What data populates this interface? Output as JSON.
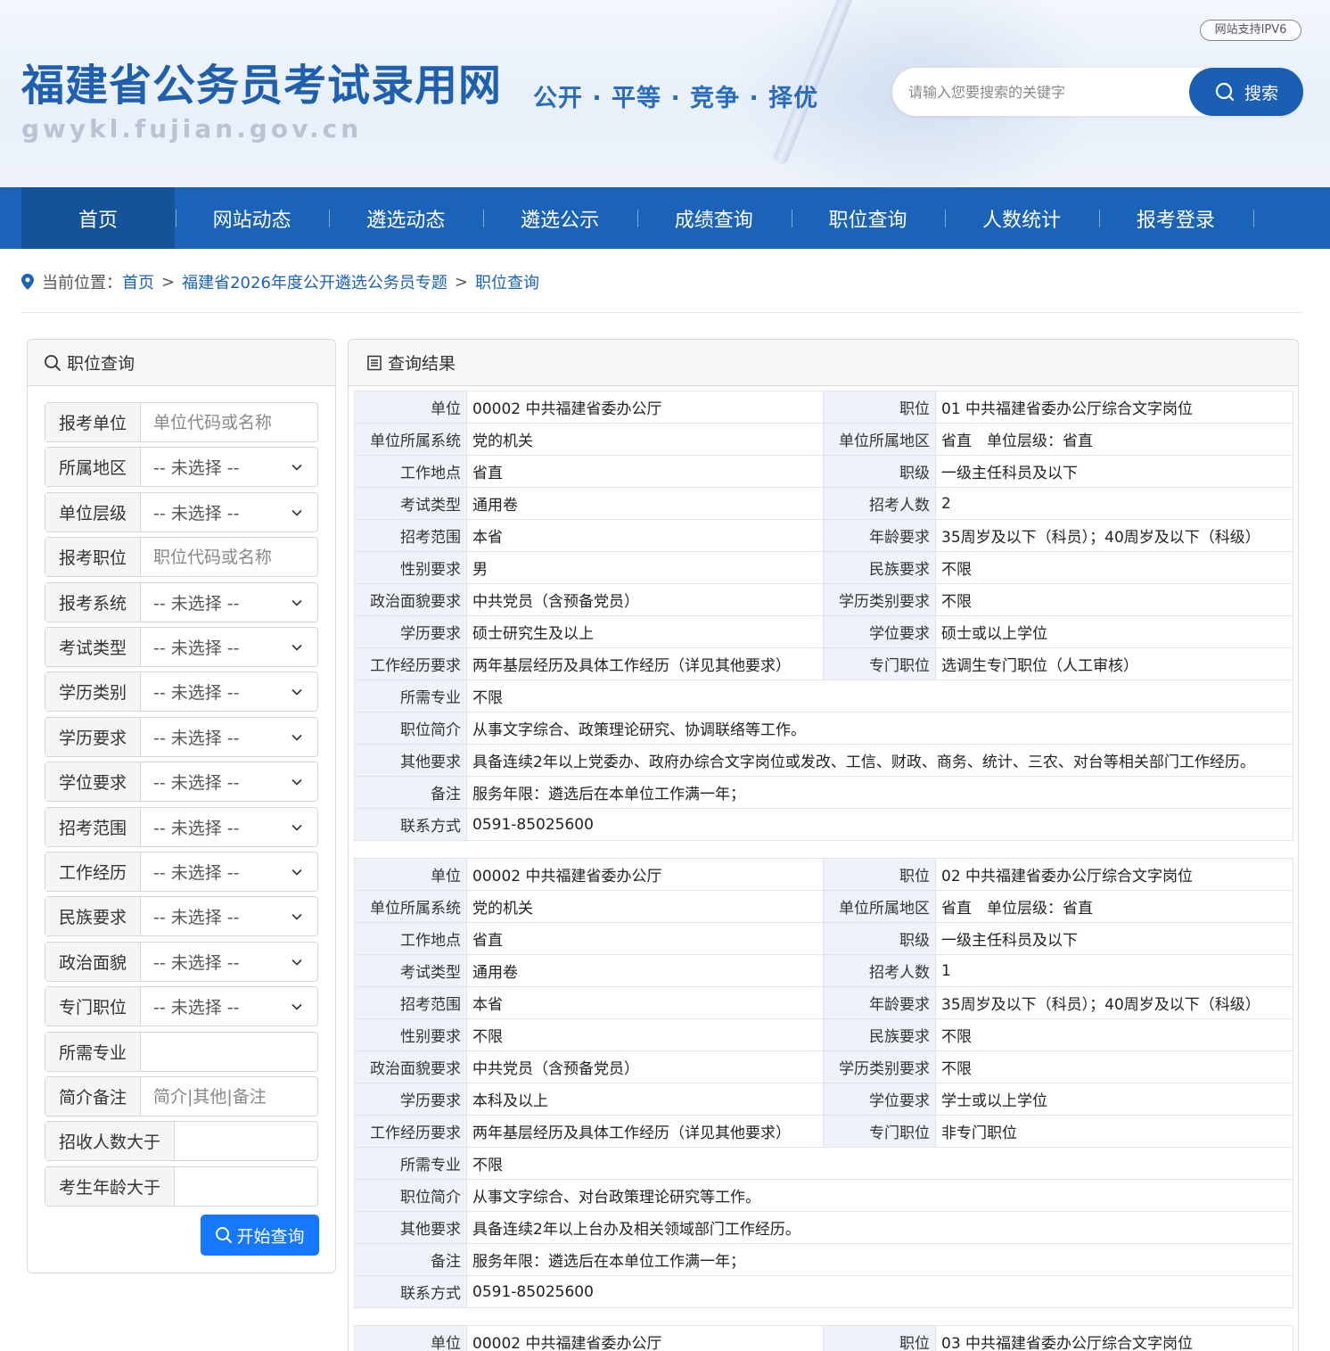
{
  "header": {
    "site_title": "福建省公务员考试录用网",
    "site_domain": "gwykl.fujian.gov.cn",
    "slogan": "公开 · 平等 · 竞争 · 择优",
    "ipv6_badge": "网站支持IPV6",
    "search_placeholder": "请输入您要搜索的关键字",
    "search_button": "搜索"
  },
  "nav": [
    "首页",
    "网站动态",
    "遴选动态",
    "遴选公示",
    "成绩查询",
    "职位查询",
    "人数统计",
    "报考登录"
  ],
  "breadcrumb": {
    "prefix": "当前位置：",
    "items": [
      "首页",
      "福建省2026年度公开遴选公务员专题",
      "职位查询"
    ],
    "sep": ">"
  },
  "left_panel": {
    "title": "职位查询",
    "fields": [
      {
        "label": "报考单位",
        "type": "input",
        "placeholder": "单位代码或名称",
        "value": ""
      },
      {
        "label": "所属地区",
        "type": "select",
        "value": "-- 未选择 --"
      },
      {
        "label": "单位层级",
        "type": "select",
        "value": "-- 未选择 --"
      },
      {
        "label": "报考职位",
        "type": "input",
        "placeholder": "职位代码或名称",
        "value": ""
      },
      {
        "label": "报考系统",
        "type": "select",
        "value": "-- 未选择 --"
      },
      {
        "label": "考试类型",
        "type": "select",
        "value": "-- 未选择 --"
      },
      {
        "label": "学历类别",
        "type": "select",
        "value": "-- 未选择 --"
      },
      {
        "label": "学历要求",
        "type": "select",
        "value": "-- 未选择 --"
      },
      {
        "label": "学位要求",
        "type": "select",
        "value": "-- 未选择 --"
      },
      {
        "label": "招考范围",
        "type": "select",
        "value": "-- 未选择 --"
      },
      {
        "label": "工作经历",
        "type": "select",
        "value": "-- 未选择 --"
      },
      {
        "label": "民族要求",
        "type": "select",
        "value": "-- 未选择 --"
      },
      {
        "label": "政治面貌",
        "type": "select",
        "value": "-- 未选择 --"
      },
      {
        "label": "专门职位",
        "type": "select",
        "value": "-- 未选择 --"
      },
      {
        "label": "所需专业",
        "type": "input",
        "placeholder": "",
        "value": ""
      },
      {
        "label": "简介备注",
        "type": "input",
        "placeholder": "简介|其他|备注",
        "value": ""
      },
      {
        "label": "招收人数大于",
        "type": "input",
        "placeholder": "",
        "value": ""
      },
      {
        "label": "考生年龄大于",
        "type": "input",
        "placeholder": "",
        "value": ""
      }
    ],
    "submit": "开始查询"
  },
  "right_panel": {
    "title": "查询结果",
    "results": [
      {
        "pairs": [
          [
            "单位",
            "00002 中共福建省委办公厅",
            "职位",
            "01 中共福建省委办公厅综合文字岗位"
          ],
          [
            "单位所属系统",
            "党的机关",
            "单位所属地区",
            "省直　单位层级：省直"
          ],
          [
            "工作地点",
            "省直",
            "职级",
            "一级主任科员及以下"
          ],
          [
            "考试类型",
            "通用卷",
            "招考人数",
            "2"
          ],
          [
            "招考范围",
            "本省",
            "年龄要求",
            "35周岁及以下（科员）；40周岁及以下（科级）"
          ],
          [
            "性别要求",
            "男",
            "民族要求",
            "不限"
          ],
          [
            "政治面貌要求",
            "中共党员（含预备党员）",
            "学历类别要求",
            "不限"
          ],
          [
            "学历要求",
            "硕士研究生及以上",
            "学位要求",
            "硕士或以上学位"
          ],
          [
            "工作经历要求",
            "两年基层经历及具体工作经历（详见其他要求）",
            "专门职位",
            "选调生专门职位（人工审核）"
          ]
        ],
        "full": [
          [
            "所需专业",
            "不限"
          ],
          [
            "职位简介",
            "从事文字综合、政策理论研究、协调联络等工作。"
          ],
          [
            "其他要求",
            "具备连续2年以上党委办、政府办综合文字岗位或发改、工信、财政、商务、统计、三农、对台等相关部门工作经历。"
          ],
          [
            "备注",
            "服务年限：遴选后在本单位工作满一年；"
          ],
          [
            "联系方式",
            "0591-85025600"
          ]
        ]
      },
      {
        "pairs": [
          [
            "单位",
            "00002 中共福建省委办公厅",
            "职位",
            "02 中共福建省委办公厅综合文字岗位"
          ],
          [
            "单位所属系统",
            "党的机关",
            "单位所属地区",
            "省直　单位层级：省直"
          ],
          [
            "工作地点",
            "省直",
            "职级",
            "一级主任科员及以下"
          ],
          [
            "考试类型",
            "通用卷",
            "招考人数",
            "1"
          ],
          [
            "招考范围",
            "本省",
            "年龄要求",
            "35周岁及以下（科员）；40周岁及以下（科级）"
          ],
          [
            "性别要求",
            "不限",
            "民族要求",
            "不限"
          ],
          [
            "政治面貌要求",
            "中共党员（含预备党员）",
            "学历类别要求",
            "不限"
          ],
          [
            "学历要求",
            "本科及以上",
            "学位要求",
            "学士或以上学位"
          ],
          [
            "工作经历要求",
            "两年基层经历及具体工作经历（详见其他要求）",
            "专门职位",
            "非专门职位"
          ]
        ],
        "full": [
          [
            "所需专业",
            "不限"
          ],
          [
            "职位简介",
            "从事文字综合、对台政策理论研究等工作。"
          ],
          [
            "其他要求",
            "具备连续2年以上台办及相关领域部门工作经历。"
          ],
          [
            "备注",
            "服务年限：遴选后在本单位工作满一年；"
          ],
          [
            "联系方式",
            "0591-85025600"
          ]
        ]
      },
      {
        "pairs": [
          [
            "单位",
            "00002 中共福建省委办公厅",
            "职位",
            "03 中共福建省委办公厅综合文字岗位"
          ]
        ],
        "full": []
      }
    ]
  }
}
